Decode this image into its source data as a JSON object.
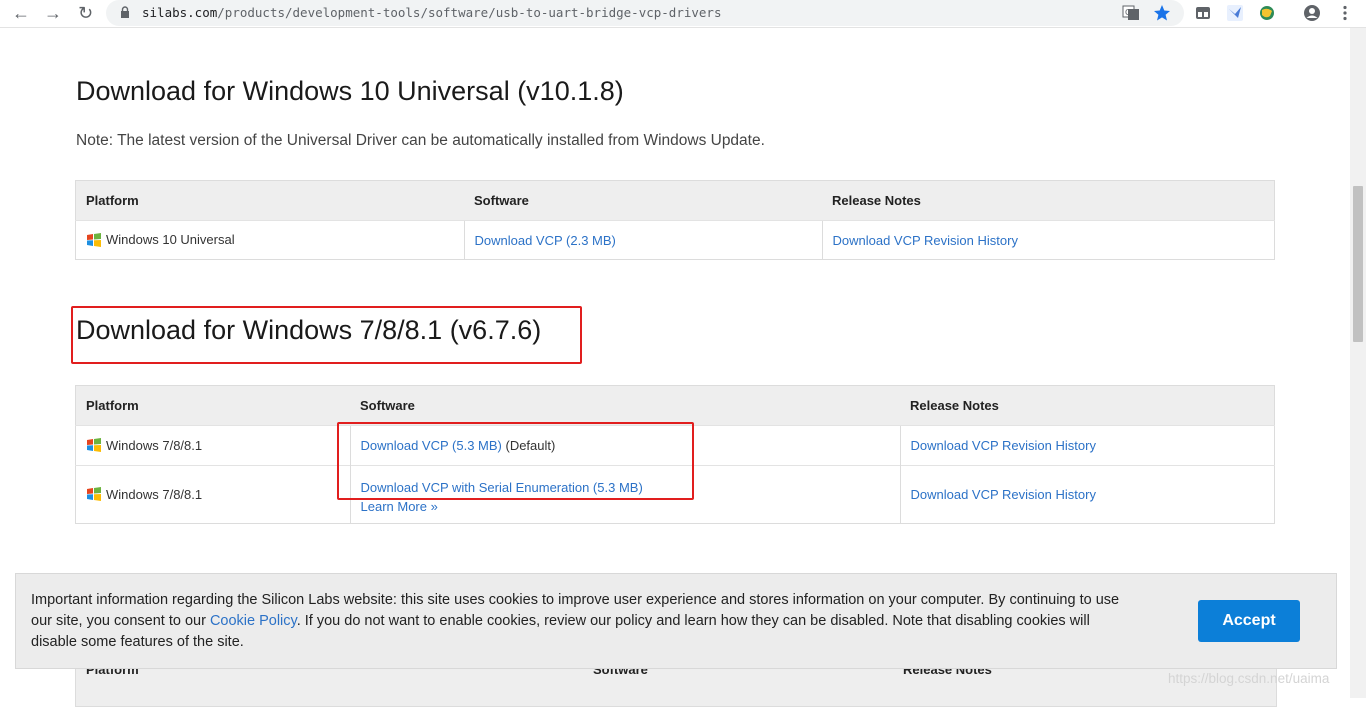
{
  "browser": {
    "url_host": "silabs.com",
    "url_path": "/products/development-tools/software/usb-to-uart-bridge-vcp-drivers",
    "icons": [
      "back-icon",
      "forward-icon",
      "reload-icon",
      "lock-icon",
      "translate-icon",
      "star-icon",
      "extension-icon",
      "bird-extension-icon",
      "globe-extension-icon",
      "profile-icon",
      "menu-icon"
    ]
  },
  "section1": {
    "title": "Download for Windows 10 Universal (v10.1.8)",
    "note": "Note: The latest version of the Universal Driver can be automatically installed from Windows Update.",
    "headers": [
      "Platform",
      "Software",
      "Release Notes"
    ],
    "rows": [
      {
        "platform": "Windows 10 Universal",
        "software": "Download VCP (2.3 MB)",
        "notes": "Download VCP Revision History"
      }
    ]
  },
  "section2": {
    "title": "Download for Windows 7/8/8.1 (v6.7.6)",
    "headers": [
      "Platform",
      "Software",
      "Release Notes"
    ],
    "rows": [
      {
        "platform": "Windows 7/8/8.1",
        "software": "Download VCP (5.3 MB)",
        "software_suffix": " (Default)",
        "notes": "Download VCP Revision History"
      },
      {
        "platform": "Windows 7/8/8.1",
        "software": "Download VCP with Serial Enumeration (5.3 MB)",
        "learn_more": "Learn More »",
        "notes": "Download VCP Revision History"
      }
    ]
  },
  "section3_headers": [
    "Platform",
    "Software",
    "Release Notes"
  ],
  "cookie": {
    "text_before": "Important information regarding the Silicon Labs website: this site uses cookies to improve user experience and stores information on your computer. By continuing to use our site, you consent to our ",
    "link": "Cookie Policy",
    "text_after": ". If you do not want to enable cookies, review our policy and learn how they can be disabled. Note that disabling cookies will disable some features of the site.",
    "accept": "Accept"
  },
  "watermark": "https://blog.csdn.net/uaima",
  "colors": {
    "link": "#2c72c7",
    "accept": "#0c7fd8",
    "highlight": "#e11e1e"
  }
}
